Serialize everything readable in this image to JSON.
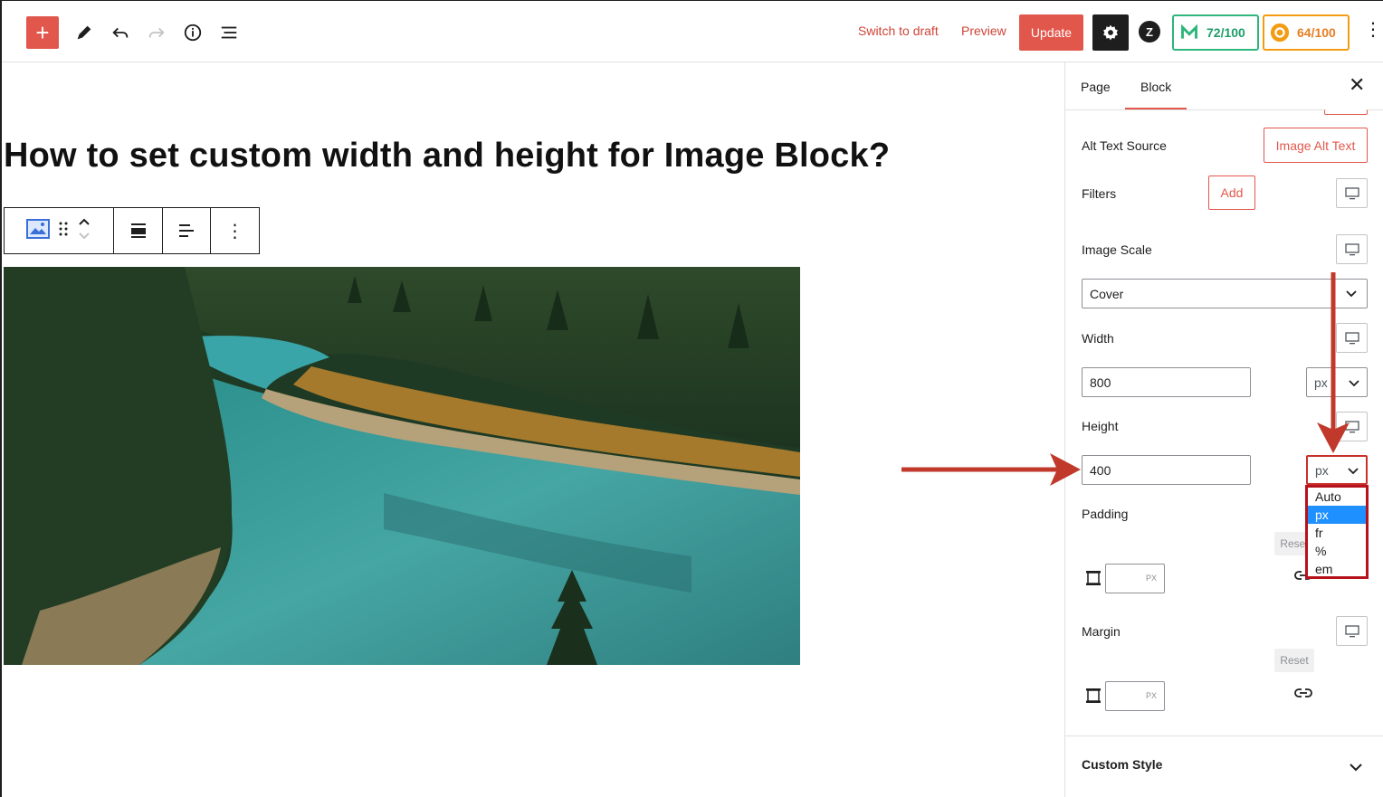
{
  "toolbar": {
    "add_icon": "plus-icon",
    "switch_to_draft": "Switch to draft",
    "preview": "Preview",
    "update": "Update",
    "seo_score": "72/100",
    "readability_score": "64/100"
  },
  "post": {
    "title": "How to set custom width and height for Image Block?"
  },
  "sidebar": {
    "tabs": [
      "Page",
      "Block"
    ],
    "active_tab": "Block",
    "alt_text_source_label": "Alt Text Source",
    "alt_text_source_button": "Image Alt Text",
    "filters_label": "Filters",
    "filters_add": "Add",
    "image_scale_label": "Image Scale",
    "image_scale_value": "Cover",
    "width_label": "Width",
    "width_value": "800",
    "width_unit": "px",
    "height_label": "Height",
    "height_value": "400",
    "height_unit": "px",
    "padding_label": "Padding",
    "padding_reset": "Reset",
    "padding_unit": "PX",
    "margin_label": "Margin",
    "margin_reset": "Reset",
    "margin_unit": "PX",
    "custom_style": "Custom Style"
  },
  "unit_dropdown": {
    "options": [
      "Auto",
      "px",
      "fr",
      "%",
      "em"
    ],
    "selected": "px"
  },
  "colors": {
    "accent": "#e2574c",
    "annotation_arrow": "#c0392b",
    "dropdown_highlight": "#1e90ff"
  }
}
